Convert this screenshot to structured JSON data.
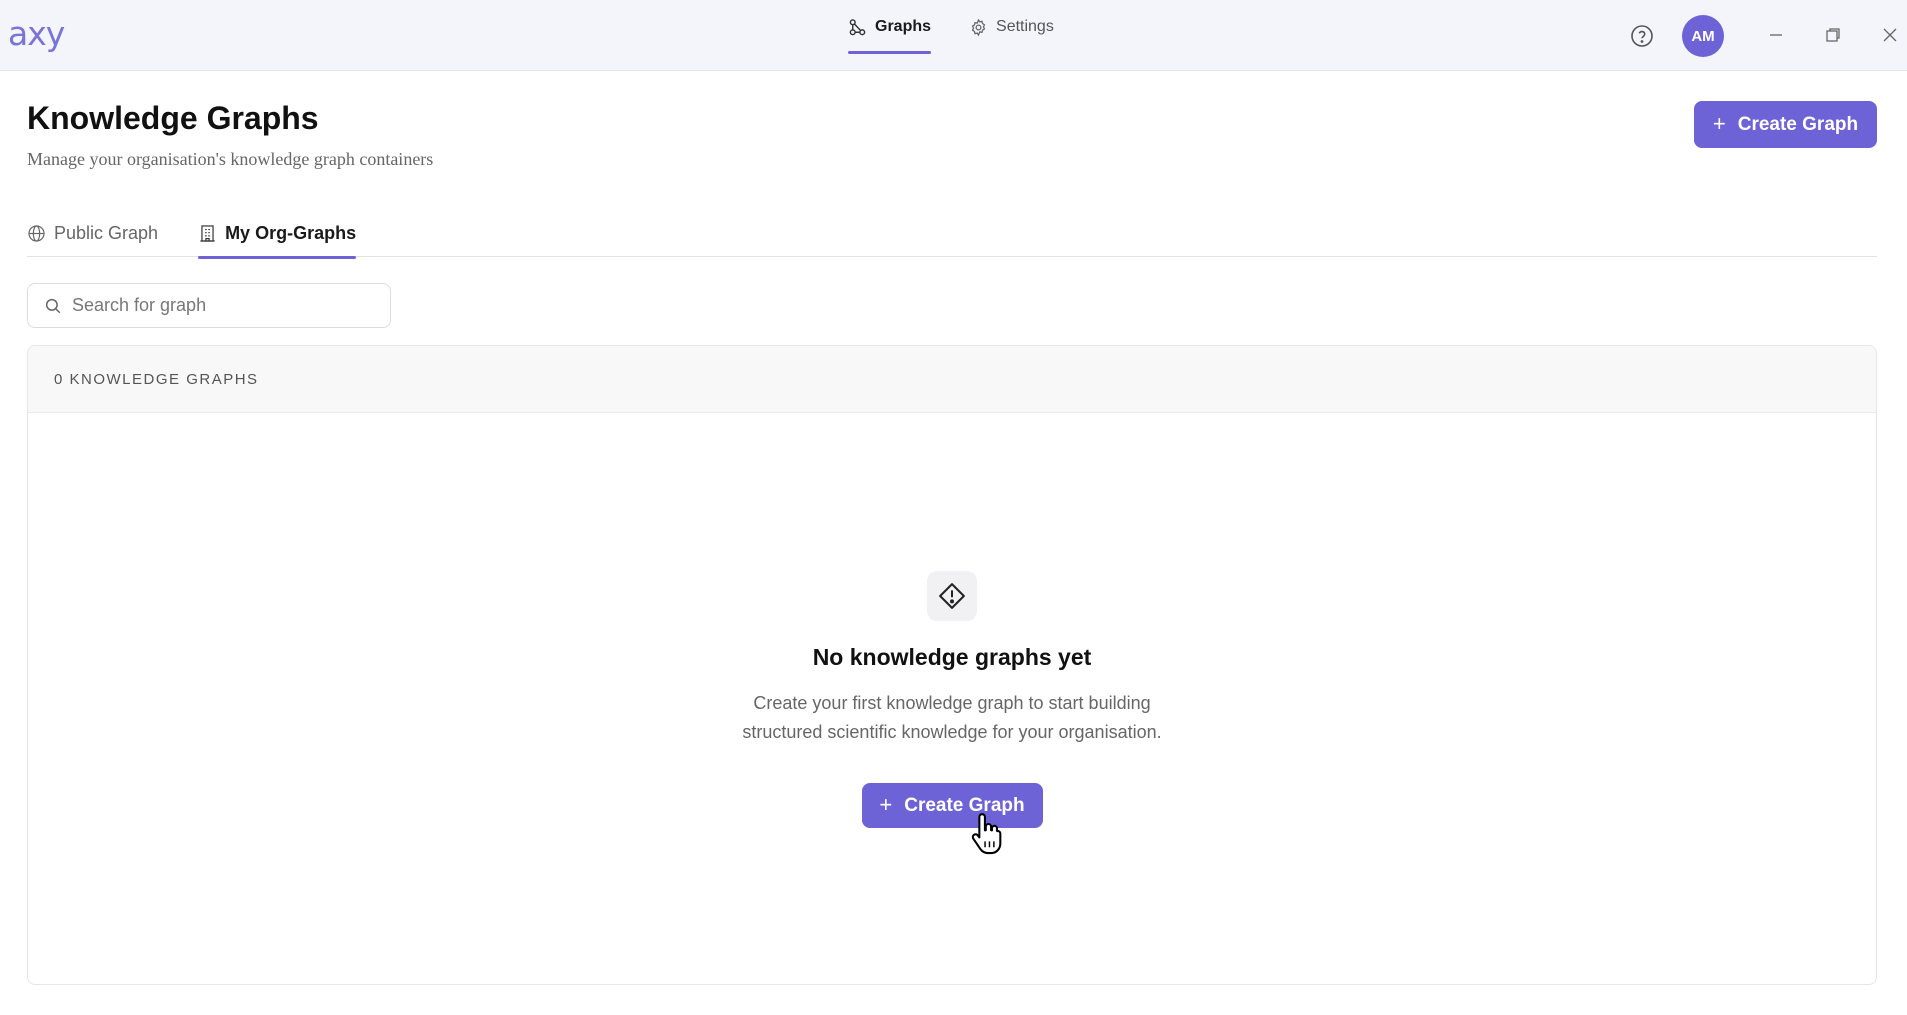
{
  "app": {
    "logo_text": "axy"
  },
  "nav": [
    {
      "label": "Graphs",
      "icon": "graph-icon",
      "active": true
    },
    {
      "label": "Settings",
      "icon": "gear-icon",
      "active": false
    }
  ],
  "user": {
    "initials": "AM"
  },
  "header": {
    "title": "Knowledge Graphs",
    "subtitle": "Manage your organisation's knowledge graph containers",
    "create_button_label": "Create Graph"
  },
  "tabs": [
    {
      "label": "Public Graph",
      "icon": "globe-icon",
      "active": false
    },
    {
      "label": "My Org-Graphs",
      "icon": "building-icon",
      "active": true
    }
  ],
  "search": {
    "placeholder": "Search for graph",
    "value": ""
  },
  "panel": {
    "count_label": "0 KNOWLEDGE GRAPHS",
    "empty_title": "No knowledge graphs yet",
    "empty_description_line1": "Create your first knowledge graph to start building",
    "empty_description_line2": "structured scientific knowledge for your organisation.",
    "empty_button_label": "Create Graph"
  },
  "colors": {
    "accent": "#6d63d6",
    "topbar_bg": "#f3f5fb"
  }
}
